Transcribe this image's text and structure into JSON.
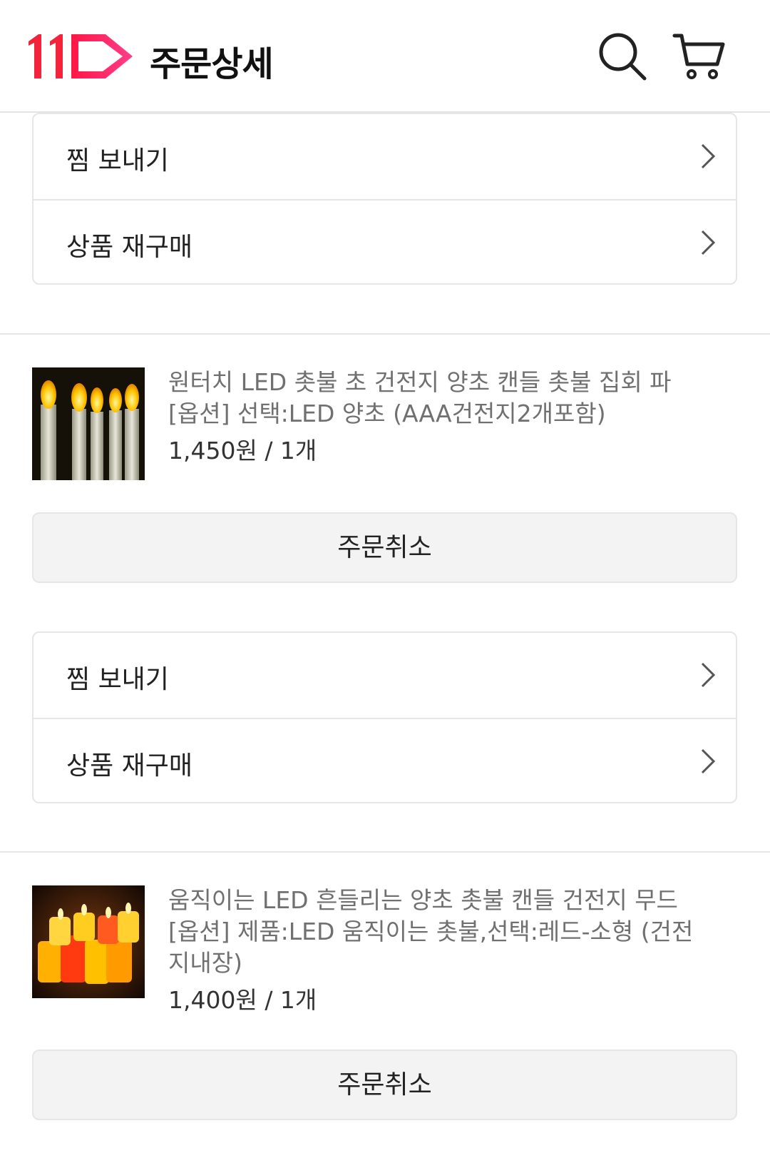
{
  "header": {
    "title": "주문상세",
    "logo_icon": "11st-logo-icon",
    "search_icon": "search-icon",
    "cart_icon": "cart-icon"
  },
  "product1": {
    "actions": [
      {
        "label": "찜 보내기"
      },
      {
        "label": "상품 재구매"
      }
    ]
  },
  "product2": {
    "name": "원터치 LED 촛불 초 건전지 양초 캔들 촛불 집회 파",
    "option": "[옵션] 선택:LED 양초 (AAA건전지2개포함)",
    "price": "1,450원 / 1개",
    "cancel_label": "주문취소",
    "actions": [
      {
        "label": "찜 보내기"
      },
      {
        "label": "상품 재구매"
      }
    ]
  },
  "product3": {
    "name": "움직이는 LED 흔들리는 양초 촛불 캔들 건전지 무드",
    "option": "[옵션] 제품:LED 움직이는 촛불,선택:레드-소형 (건전지내장)",
    "price": "1,400원 / 1개",
    "cancel_label": "주문취소"
  },
  "colors": {
    "brand_red": "#ff0038",
    "brand_pink": "#ff5a8c",
    "border": "#e6e6e6",
    "button_bg": "#f3f3f3"
  }
}
